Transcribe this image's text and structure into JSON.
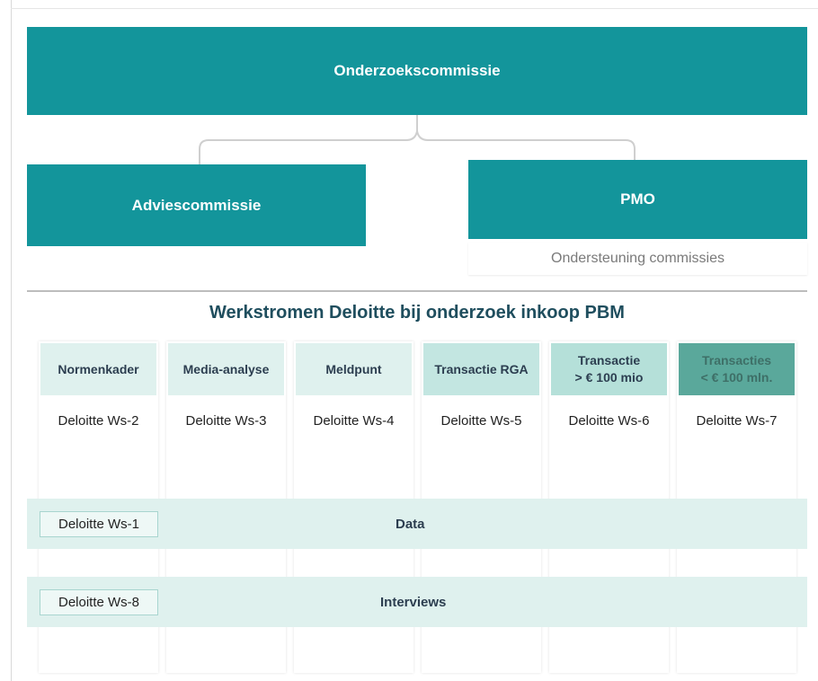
{
  "org": {
    "top": "Onderzoekscommissie",
    "left": "Adviescommissie",
    "right": "PMO",
    "right_sub": "Ondersteuning commissies"
  },
  "section_title": "Werkstromen Deloitte bij onderzoek inkoop PBM",
  "columns": [
    {
      "header": "Normenkader",
      "workstream": "Deloitte Ws-2",
      "header_bg": "#dff1ee",
      "header_color": "#2c3e50"
    },
    {
      "header": "Media-analyse",
      "workstream": "Deloitte Ws-3",
      "header_bg": "#dff1ee",
      "header_color": "#2c3e50"
    },
    {
      "header": "Meldpunt",
      "workstream": "Deloitte Ws-4",
      "header_bg": "#dff1ee",
      "header_color": "#2c3e50"
    },
    {
      "header": "Transactie RGA",
      "workstream": "Deloitte Ws-5",
      "header_bg": "#c3e6e1",
      "header_color": "#2c3e50"
    },
    {
      "header": "Transactie\n> € 100 mio",
      "workstream": "Deloitte Ws-6",
      "header_bg": "#b5e0d9",
      "header_color": "#2c3e50"
    },
    {
      "header": "Transacties\n< € 100 mln.",
      "workstream": "Deloitte Ws-7",
      "header_bg": "#5aa89b",
      "header_color": "#3e6f67"
    }
  ],
  "bands": [
    {
      "tag": "Deloitte Ws-1",
      "label": "Data"
    },
    {
      "tag": "Deloitte Ws-8",
      "label": "Interviews"
    }
  ],
  "colors": {
    "teal": "#13959b",
    "band": "#dff1ee",
    "title": "#1f4e5e"
  }
}
